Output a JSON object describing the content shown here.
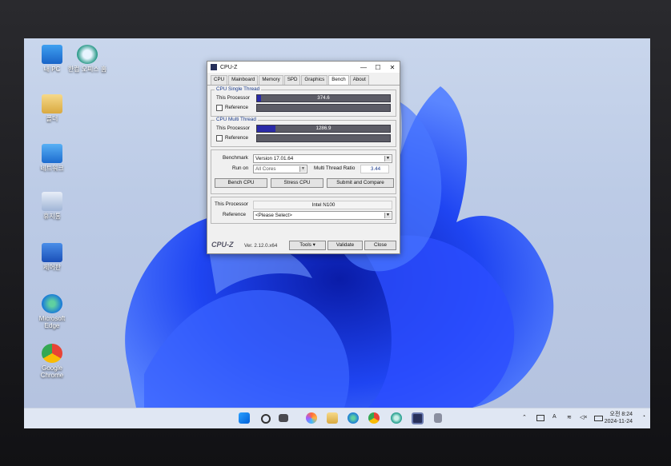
{
  "desktop": {
    "icons": [
      {
        "label": "내 PC",
        "glyph": "monitor-icon"
      },
      {
        "label": "한컴 오피스 홈",
        "glyph": "app-icon"
      },
      {
        "label": "폴더",
        "glyph": "folder-icon"
      },
      {
        "label": "네트워크",
        "glyph": "network-icon"
      },
      {
        "label": "휴지통",
        "glyph": "recycle-bin-icon"
      },
      {
        "label": "제어판",
        "glyph": "control-panel-icon"
      },
      {
        "label": "Microsoft Edge",
        "glyph": "edge-icon"
      },
      {
        "label": "Google Chrome",
        "glyph": "chrome-icon"
      }
    ]
  },
  "window": {
    "title": "CPU-Z",
    "controls": {
      "minimize": "—",
      "maximize": "☐",
      "close": "✕"
    },
    "tabs": [
      "CPU",
      "Mainboard",
      "Memory",
      "SPD",
      "Graphics",
      "Bench",
      "About"
    ],
    "active_tab": "Bench",
    "single_thread": {
      "heading": "CPU Single Thread",
      "this_label": "This Processor",
      "this_value": "374.6",
      "this_fraction": 0.03,
      "ref_label": "Reference"
    },
    "multi_thread": {
      "heading": "CPU Multi Thread",
      "this_label": "This Processor",
      "this_value": "1286.9",
      "this_fraction": 0.14,
      "ref_label": "Reference"
    },
    "benchmark_label": "Benchmark",
    "benchmark_value": "Version 17.01.64",
    "runon_label": "Run on",
    "runon_value": "All Cores",
    "ratio_label": "Multi Thread Ratio",
    "ratio_value": "3.44",
    "buttons": {
      "bench": "Bench CPU",
      "stress": "Stress CPU",
      "submit": "Submit and Compare"
    },
    "this_processor_label": "This Processor",
    "this_processor_value": "Intel N100",
    "reference_label": "Reference",
    "reference_value": "<Please Select>",
    "footer": {
      "logo": "CPU-Z",
      "version": "Ver. 2.12.0.x64",
      "tools": "Tools",
      "validate": "Validate",
      "close": "Close"
    }
  },
  "taskbar": {
    "clock_time": "오전 8:24",
    "clock_date": "2024-11-24",
    "lang": "A"
  },
  "colors": {
    "accent": "#2a2aa8",
    "wallpaper_blue": "#1e3ef0"
  }
}
